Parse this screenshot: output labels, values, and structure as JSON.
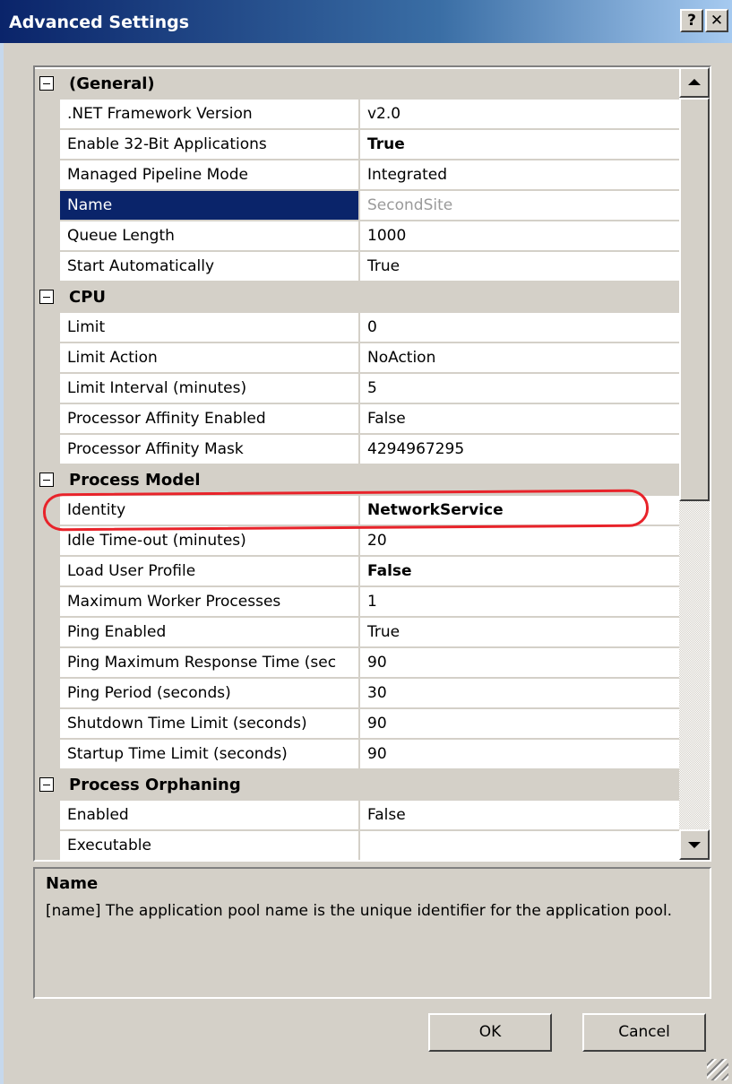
{
  "window": {
    "title": "Advanced Settings",
    "help_label": "?",
    "close_label": "✕"
  },
  "grid": {
    "sections": [
      {
        "label": "(General)",
        "props": [
          {
            "name": ".NET Framework Version",
            "value": "v2.0"
          },
          {
            "name": "Enable 32-Bit Applications",
            "value": "True",
            "bold": true
          },
          {
            "name": "Managed Pipeline Mode",
            "value": "Integrated"
          },
          {
            "name": "Name",
            "value": "SecondSite",
            "selected": true,
            "readonly": true
          },
          {
            "name": "Queue Length",
            "value": "1000"
          },
          {
            "name": "Start Automatically",
            "value": "True"
          }
        ]
      },
      {
        "label": "CPU",
        "props": [
          {
            "name": "Limit",
            "value": "0"
          },
          {
            "name": "Limit Action",
            "value": "NoAction"
          },
          {
            "name": "Limit Interval (minutes)",
            "value": "5"
          },
          {
            "name": "Processor Affinity Enabled",
            "value": "False"
          },
          {
            "name": "Processor Affinity Mask",
            "value": "4294967295"
          }
        ]
      },
      {
        "label": "Process Model",
        "props": [
          {
            "name": "Identity",
            "value": "NetworkService",
            "bold": true
          },
          {
            "name": "Idle Time-out (minutes)",
            "value": "20"
          },
          {
            "name": "Load User Profile",
            "value": "False",
            "bold": true
          },
          {
            "name": "Maximum Worker Processes",
            "value": "1"
          },
          {
            "name": "Ping Enabled",
            "value": "True"
          },
          {
            "name": "Ping Maximum Response Time (sec",
            "value": "90"
          },
          {
            "name": "Ping Period (seconds)",
            "value": "30"
          },
          {
            "name": "Shutdown Time Limit (seconds)",
            "value": "90"
          },
          {
            "name": "Startup Time Limit (seconds)",
            "value": "90"
          }
        ]
      },
      {
        "label": "Process Orphaning",
        "props": [
          {
            "name": "Enabled",
            "value": "False"
          },
          {
            "name": "Executable",
            "value": ""
          }
        ]
      }
    ]
  },
  "description": {
    "title": "Name",
    "text": "[name] The application pool name is the unique identifier for the application pool."
  },
  "buttons": {
    "ok_label": "OK",
    "cancel_label": "Cancel"
  },
  "colors": {
    "selection": "#0a246a",
    "annotation": "#e8232a"
  }
}
